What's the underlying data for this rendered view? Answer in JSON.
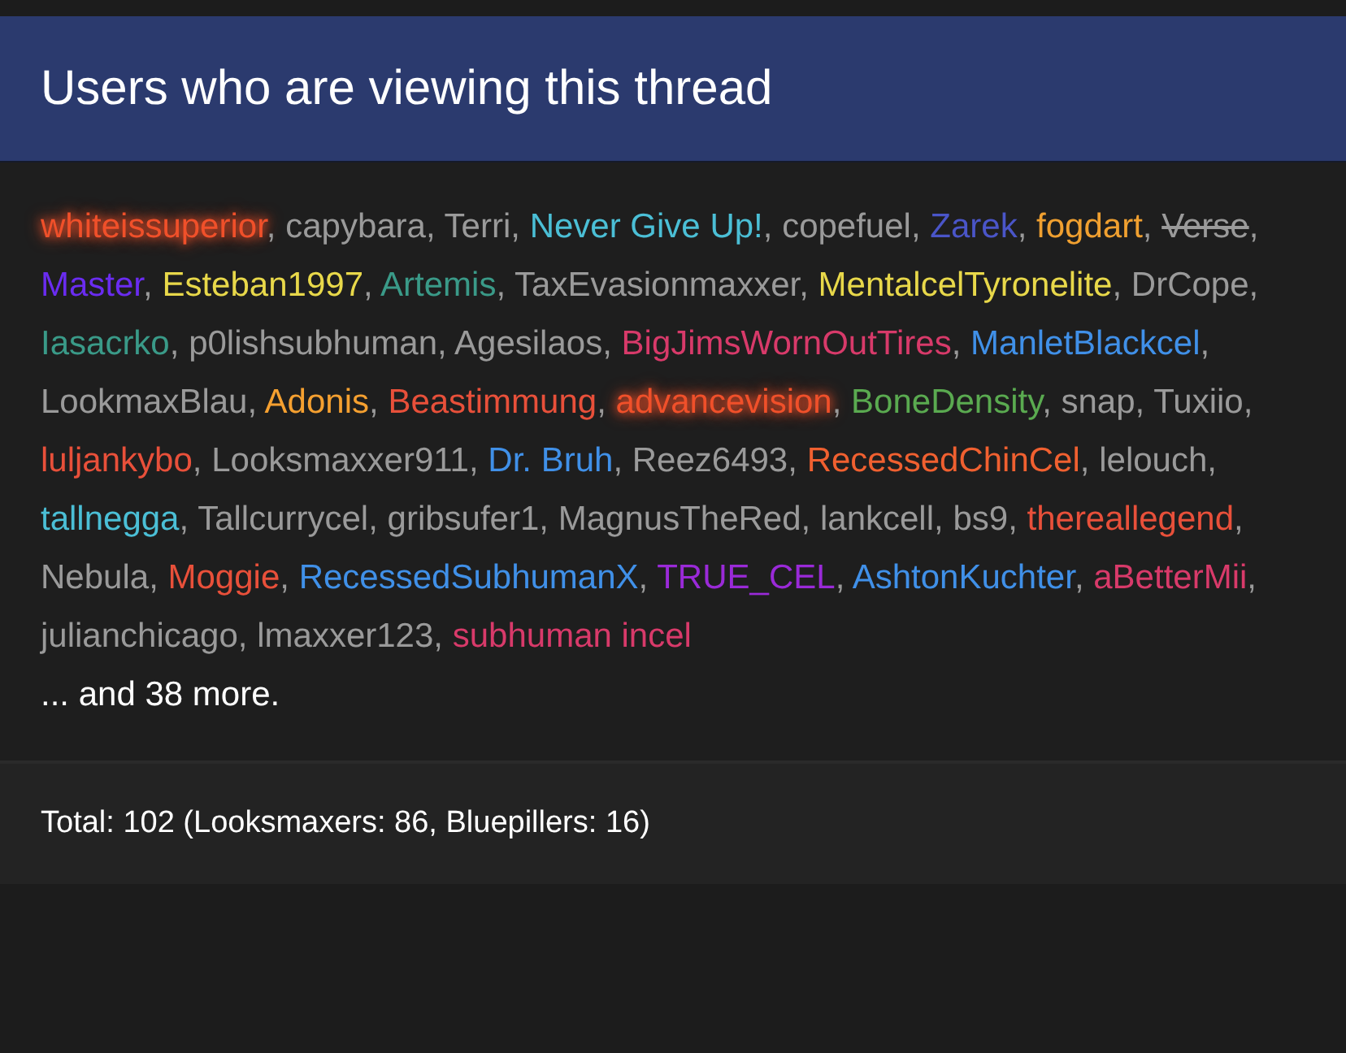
{
  "block": {
    "title": "Users who are viewing this thread",
    "separator": ",",
    "users": [
      {
        "name": "whiteissuperior",
        "color": "#f0502a",
        "glowing": true,
        "struck": false
      },
      {
        "name": "capybara",
        "color": "#9a9a9a",
        "glowing": false,
        "struck": false
      },
      {
        "name": "Terri",
        "color": "#9a9a9a",
        "glowing": false,
        "struck": false
      },
      {
        "name": "Never Give Up!",
        "color": "#4bbfd6",
        "glowing": false,
        "struck": false
      },
      {
        "name": "copefuel",
        "color": "#9a9a9a",
        "glowing": false,
        "struck": false
      },
      {
        "name": "Zarek",
        "color": "#4a55c8",
        "glowing": false,
        "struck": false
      },
      {
        "name": "fogdart",
        "color": "#f0a030",
        "glowing": false,
        "struck": false
      },
      {
        "name": "Verse",
        "color": "#9a9a9a",
        "glowing": false,
        "struck": true
      },
      {
        "name": "Master",
        "color": "#6a2cf0",
        "glowing": false,
        "struck": false
      },
      {
        "name": "Esteban1997",
        "color": "#e8d84a",
        "glowing": false,
        "struck": false
      },
      {
        "name": "Artemis",
        "color": "#3a9a88",
        "glowing": false,
        "struck": false
      },
      {
        "name": "TaxEvasionmaxxer",
        "color": "#9a9a9a",
        "glowing": false,
        "struck": false
      },
      {
        "name": "MentalcelTyronelite",
        "color": "#e8d84a",
        "glowing": false,
        "struck": false
      },
      {
        "name": "DrCope",
        "color": "#9a9a9a",
        "glowing": false,
        "struck": false
      },
      {
        "name": "Iasacrko",
        "color": "#3a9a88",
        "glowing": false,
        "struck": false
      },
      {
        "name": "p0lishsubhuman",
        "color": "#9a9a9a",
        "glowing": false,
        "struck": false
      },
      {
        "name": "Agesilaos",
        "color": "#9a9a9a",
        "glowing": false,
        "struck": false
      },
      {
        "name": "BigJimsWornOutTires",
        "color": "#d83a6a",
        "glowing": false,
        "struck": false
      },
      {
        "name": "ManletBlackcel",
        "color": "#4090e8",
        "glowing": false,
        "struck": false
      },
      {
        "name": "LookmaxBlau",
        "color": "#9a9a9a",
        "glowing": false,
        "struck": false
      },
      {
        "name": "Adonis",
        "color": "#f5a030",
        "glowing": false,
        "struck": false
      },
      {
        "name": "Beastimmung",
        "color": "#e8503a",
        "glowing": false,
        "struck": false
      },
      {
        "name": "advancevision",
        "color": "#f0502a",
        "glowing": true,
        "struck": false
      },
      {
        "name": "BoneDensity",
        "color": "#5aaa50",
        "glowing": false,
        "struck": false
      },
      {
        "name": "snap",
        "color": "#9a9a9a",
        "glowing": false,
        "struck": false
      },
      {
        "name": "Tuxiio",
        "color": "#9a9a9a",
        "glowing": false,
        "struck": false
      },
      {
        "name": "luljankybo",
        "color": "#e8503a",
        "glowing": false,
        "struck": false
      },
      {
        "name": "Looksmaxxer911",
        "color": "#9a9a9a",
        "glowing": false,
        "struck": false
      },
      {
        "name": "Dr. Bruh",
        "color": "#4090e8",
        "glowing": false,
        "struck": false
      },
      {
        "name": "Reez6493",
        "color": "#9a9a9a",
        "glowing": false,
        "struck": false
      },
      {
        "name": "RecessedChinCel",
        "color": "#f06030",
        "glowing": false,
        "struck": false
      },
      {
        "name": "lelouch",
        "color": "#9a9a9a",
        "glowing": false,
        "struck": false
      },
      {
        "name": "tallnegga",
        "color": "#4bbfd6",
        "glowing": false,
        "struck": false
      },
      {
        "name": "Tallcurrycel",
        "color": "#9a9a9a",
        "glowing": false,
        "struck": false
      },
      {
        "name": "gribsufer1",
        "color": "#9a9a9a",
        "glowing": false,
        "struck": false
      },
      {
        "name": "MagnusTheRed",
        "color": "#9a9a9a",
        "glowing": false,
        "struck": false
      },
      {
        "name": "lankcell",
        "color": "#9a9a9a",
        "glowing": false,
        "struck": false
      },
      {
        "name": "bs9",
        "color": "#9a9a9a",
        "glowing": false,
        "struck": false
      },
      {
        "name": "thereallegend",
        "color": "#e8503a",
        "glowing": false,
        "struck": false
      },
      {
        "name": "Nebula",
        "color": "#9a9a9a",
        "glowing": false,
        "struck": false
      },
      {
        "name": "Moggie",
        "color": "#e8503a",
        "glowing": false,
        "struck": false
      },
      {
        "name": "RecessedSubhumanX",
        "color": "#4090e8",
        "glowing": false,
        "struck": false
      },
      {
        "name": "TRUE_CEL",
        "color": "#9a2ad8",
        "glowing": false,
        "struck": false
      },
      {
        "name": "AshtonKuchter",
        "color": "#4090e8",
        "glowing": false,
        "struck": false
      },
      {
        "name": "aBetterMii",
        "color": "#d83a6a",
        "glowing": false,
        "struck": false
      },
      {
        "name": "julianchicago",
        "color": "#9a9a9a",
        "glowing": false,
        "struck": false
      },
      {
        "name": "lmaxxer123",
        "color": "#9a9a9a",
        "glowing": false,
        "struck": false
      },
      {
        "name": "subhuman incel",
        "color": "#d83a6a",
        "glowing": false,
        "struck": false
      }
    ],
    "more": "... and 38 more.",
    "footer": "Total: 102 (Looksmaxers: 86, Bluepillers: 16)"
  }
}
